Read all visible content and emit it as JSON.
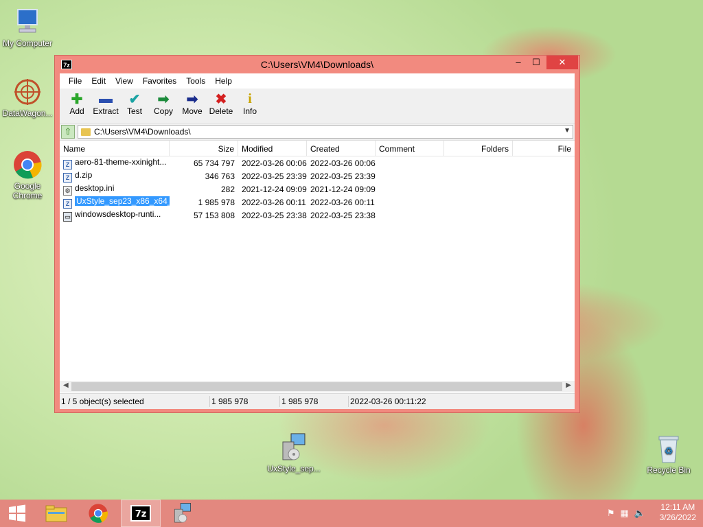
{
  "desktop": {
    "icons": [
      {
        "label": "My Computer"
      },
      {
        "label": "DataWagon..."
      },
      {
        "label": "Google Chrome"
      },
      {
        "label": "UxStyle_sep..."
      },
      {
        "label": "Recycle Bin"
      }
    ]
  },
  "window": {
    "app_icon": "7z",
    "title": "C:\\Users\\VM4\\Downloads\\",
    "controls": {
      "minimize": "–",
      "maximize": "☐",
      "close": "✕"
    }
  },
  "menu": [
    "File",
    "Edit",
    "View",
    "Favorites",
    "Tools",
    "Help"
  ],
  "toolbar": [
    {
      "label": "Add",
      "icon": "plus-icon",
      "glyph": "✚",
      "color": "#2aa62a"
    },
    {
      "label": "Extract",
      "icon": "minus-icon",
      "glyph": "▬",
      "color": "#2b4fb0"
    },
    {
      "label": "Test",
      "icon": "check-icon",
      "glyph": "✔",
      "color": "#1aa3a3"
    },
    {
      "label": "Copy",
      "icon": "copy-arrow-icon",
      "glyph": "➡",
      "color": "#1b8a3a"
    },
    {
      "label": "Move",
      "icon": "move-arrow-icon",
      "glyph": "➡",
      "color": "#1a2c8c"
    },
    {
      "label": "Delete",
      "icon": "delete-x-icon",
      "glyph": "✖",
      "color": "#d42020"
    },
    {
      "label": "Info",
      "icon": "info-icon",
      "glyph": "i",
      "color": "#c8a400"
    }
  ],
  "address": {
    "path": "C:\\Users\\VM4\\Downloads\\"
  },
  "columns": [
    "Name",
    "Size",
    "Modified",
    "Created",
    "Comment",
    "Folders",
    "File"
  ],
  "files": [
    {
      "name": "aero-81-theme-xxinight...",
      "size": "65 734 797",
      "modified": "2022-03-26 00:06",
      "created": "2022-03-26 00:06",
      "type": "zip",
      "selected": false
    },
    {
      "name": "d.zip",
      "size": "346 763",
      "modified": "2022-03-25 23:39",
      "created": "2022-03-25 23:39",
      "type": "zip",
      "selected": false
    },
    {
      "name": "desktop.ini",
      "size": "282",
      "modified": "2021-12-24 09:09",
      "created": "2021-12-24 09:09",
      "type": "ini",
      "selected": false
    },
    {
      "name": "UxStyle_sep23_x86_x64_...",
      "size": "1 985 978",
      "modified": "2022-03-26 00:11",
      "created": "2022-03-26 00:11",
      "type": "zip",
      "selected": true
    },
    {
      "name": "windowsdesktop-runti...",
      "size": "57 153 808",
      "modified": "2022-03-25 23:38",
      "created": "2022-03-25 23:38",
      "type": "exe",
      "selected": false
    }
  ],
  "status": {
    "selected": "1 / 5 object(s) selected",
    "size1": "1 985 978",
    "size2": "1 985 978",
    "datetime": "2022-03-26 00:11:22"
  },
  "taskbar": {
    "time": "12:11 AM",
    "date": "3/26/2022"
  }
}
